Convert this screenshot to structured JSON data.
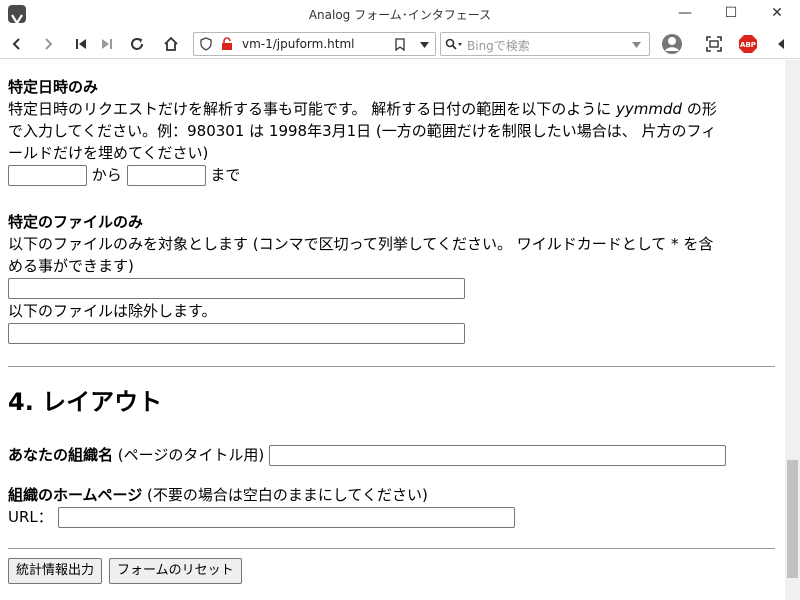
{
  "window": {
    "title": "Analog フォーム･インタフェース",
    "minimize": "—",
    "maximize": "☐",
    "close": "✕"
  },
  "toolbar": {
    "url": "vm-1/jpuform.html",
    "search_placeholder": "Bingで検索"
  },
  "date_section": {
    "heading": "特定日時のみ",
    "desc_1": "特定日時のリクエストだけを解析する事も可能です。 解析する日付の範囲を以下のように ",
    "desc_format": "yymmdd",
    "desc_2": " の形",
    "desc_line2": "で入力してください。例：980301 は 1998年3月1日 (一方の範囲だけを制限したい場合は、 片方のフィ",
    "desc_line3": "ールドだけを埋めてください)",
    "from_label": "から",
    "to_label": "まで"
  },
  "file_section": {
    "heading": "特定のファイルのみ",
    "include_desc_1": "以下のファイルのみを対象とします (コンマで区切って列挙してください。 ワイルドカードとして * を含",
    "include_desc_2": "める事ができます)",
    "exclude_desc": "以下のファイルは除外します。"
  },
  "layout_section": {
    "heading": "4. レイアウト",
    "org_label": "あなたの組織名",
    "org_note": " (ページのタイトル用)",
    "homepage_label": "組織のホームページ",
    "homepage_note": " (不要の場合は空白のままにしてください)",
    "url_label": "URL："
  },
  "buttons": {
    "submit": "統計情報出力",
    "reset": "フォームのリセット"
  },
  "colors": {
    "abp_red": "#d9251c",
    "lock_red": "#d9251c"
  }
}
